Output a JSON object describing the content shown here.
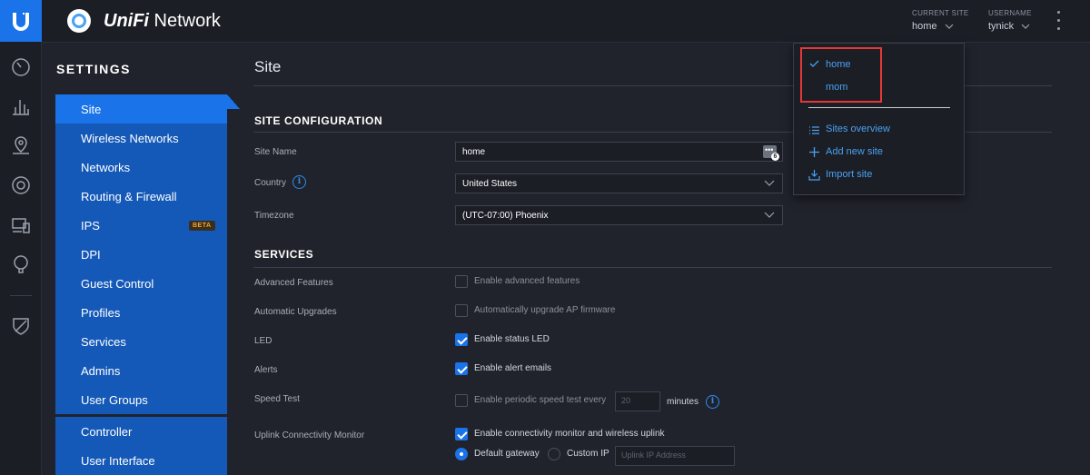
{
  "app": {
    "brand_prefix": "UniFi",
    "brand_suffix": " Network"
  },
  "topbar": {
    "current_site_label": "CURRENT SITE",
    "current_site_value": "home",
    "username_label": "USERNAME",
    "username_value": "tynick"
  },
  "sidebar": {
    "title": "SETTINGS",
    "items": [
      {
        "label": "Site",
        "active": true
      },
      {
        "label": "Wireless Networks"
      },
      {
        "label": "Networks"
      },
      {
        "label": "Routing & Firewall"
      },
      {
        "label": "IPS",
        "badge": "BETA"
      },
      {
        "label": "DPI"
      },
      {
        "label": "Guest Control"
      },
      {
        "label": "Profiles"
      },
      {
        "label": "Services"
      },
      {
        "label": "Admins"
      },
      {
        "label": "User Groups"
      }
    ],
    "items2": [
      {
        "label": "Controller"
      },
      {
        "label": "User Interface"
      }
    ]
  },
  "main": {
    "page_title": "Site",
    "site_config": {
      "title": "SITE CONFIGURATION",
      "site_name_label": "Site Name",
      "site_name_value": "home",
      "password_icon_badge": "6",
      "country_label": "Country",
      "country_value": "United States",
      "timezone_label": "Timezone",
      "timezone_value": "(UTC-07:00) Phoenix"
    },
    "services": {
      "title": "SERVICES",
      "advanced_label": "Advanced Features",
      "advanced_cb": "Enable advanced features",
      "upgrades_label": "Automatic Upgrades",
      "upgrades_cb": "Automatically upgrade AP firmware",
      "led_label": "LED",
      "led_cb": "Enable status LED",
      "alerts_label": "Alerts",
      "alerts_cb": "Enable alert emails",
      "speedtest_label": "Speed Test",
      "speedtest_cb": "Enable periodic speed test every",
      "speedtest_placeholder": "20",
      "speedtest_unit": "minutes",
      "uplink_label": "Uplink Connectivity Monitor",
      "uplink_cb": "Enable connectivity monitor and wireless uplink",
      "radio_default": "Default gateway",
      "radio_custom": "Custom IP",
      "uplink_placeholder": "Uplink IP Address"
    }
  },
  "site_dropdown": {
    "sites": [
      "home",
      "mom"
    ],
    "selected": "home",
    "actions": [
      "Sites overview",
      "Add new site",
      "Import site"
    ]
  },
  "colors": {
    "accent": "#1a73e8",
    "nav_bg": "#1559b8",
    "highlight": "#e53935",
    "link": "#4aa1f2"
  }
}
